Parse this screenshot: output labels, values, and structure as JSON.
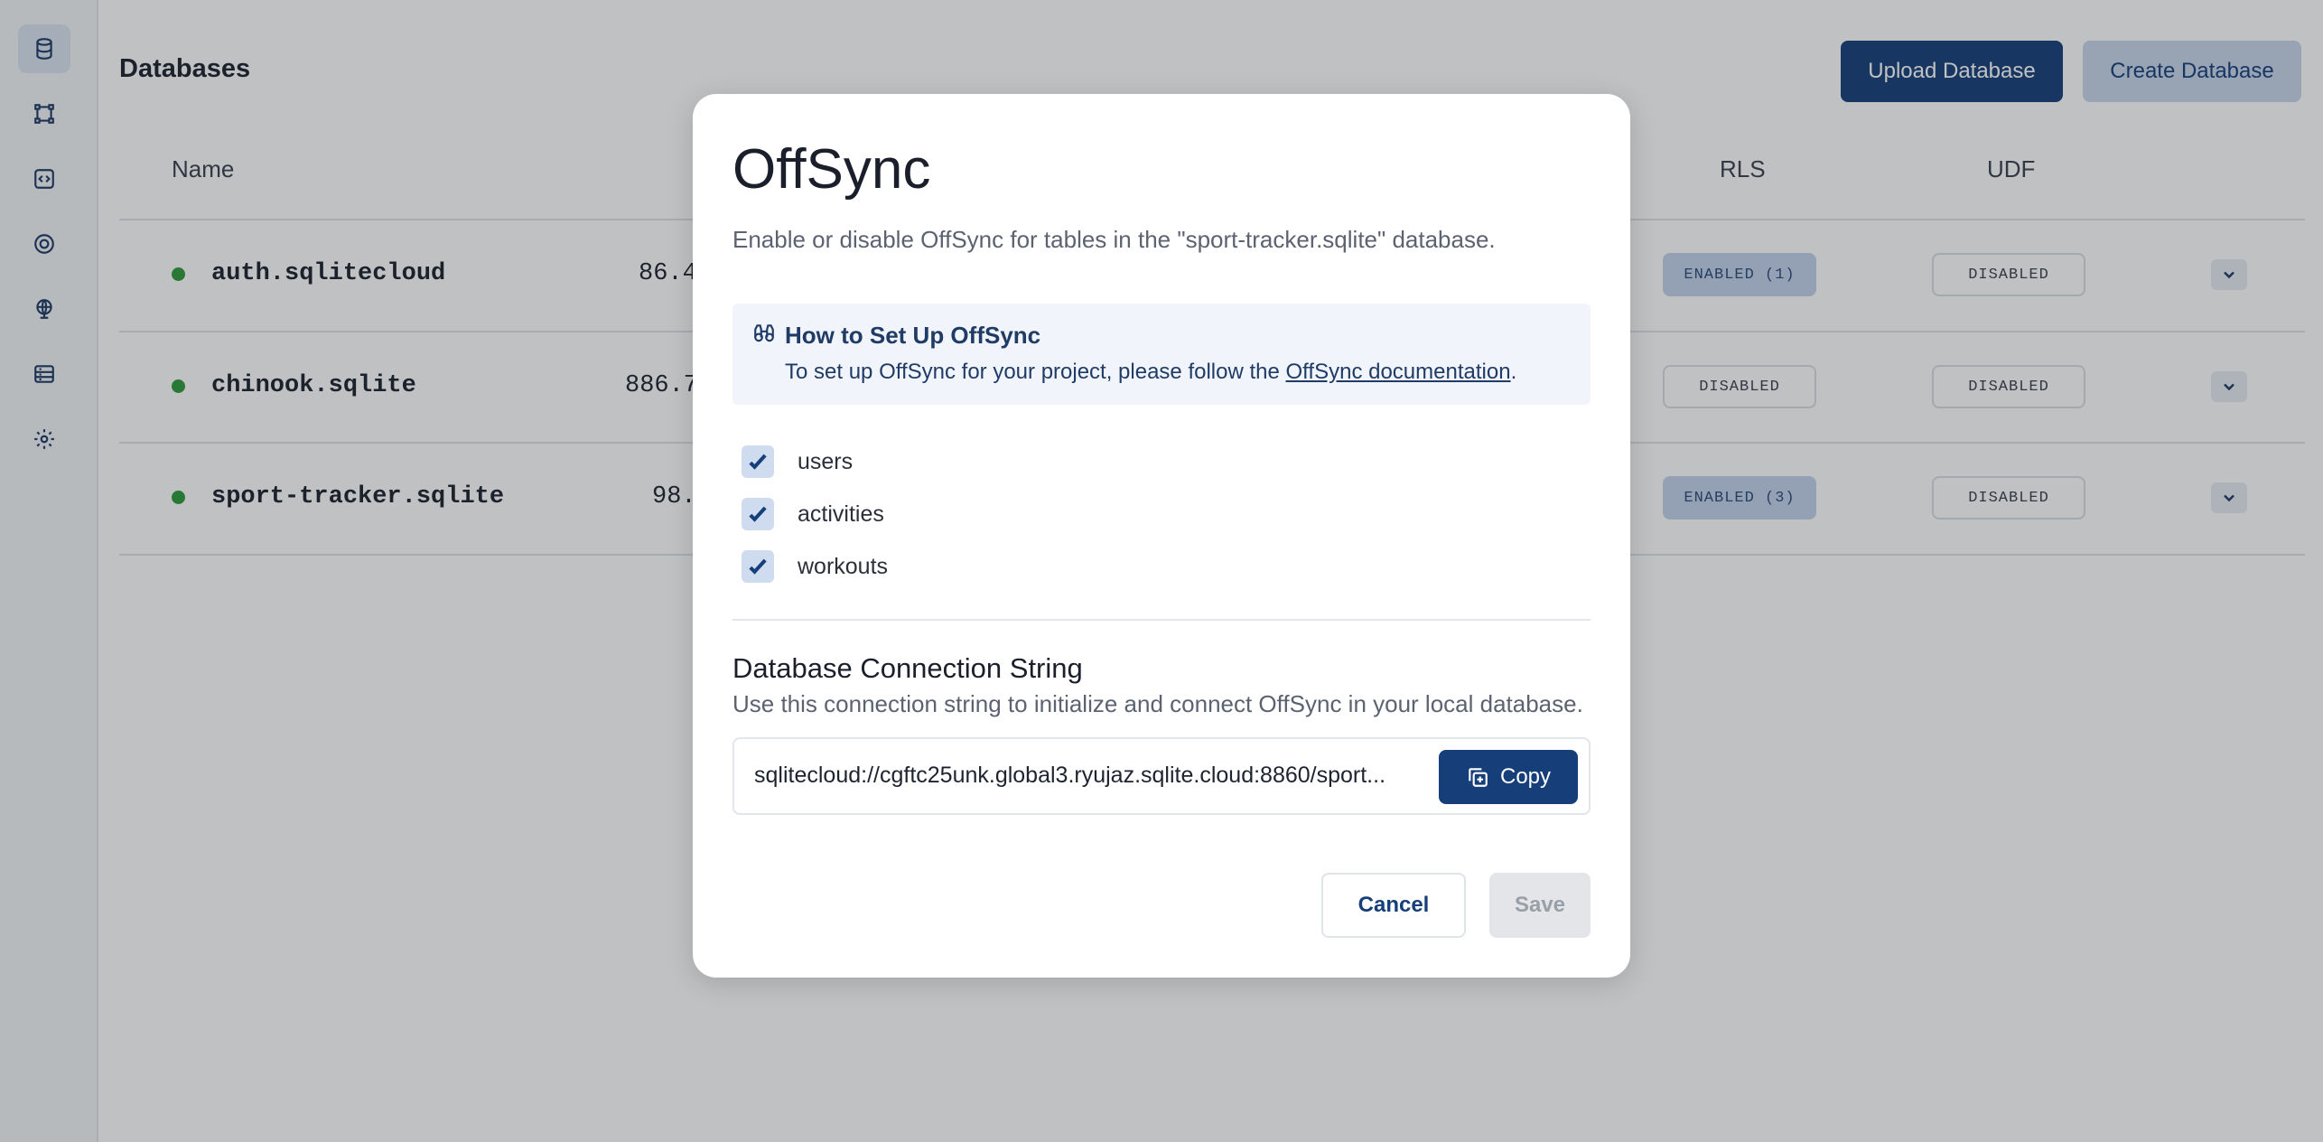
{
  "sidebar": {
    "items": [
      {
        "icon": "database-icon",
        "active": true
      },
      {
        "icon": "nodes-icon",
        "active": false
      },
      {
        "icon": "functions-icon",
        "active": false
      },
      {
        "icon": "gauge-icon",
        "active": false
      },
      {
        "icon": "globe-icon",
        "active": false
      },
      {
        "icon": "server-icon",
        "active": false
      },
      {
        "icon": "gear-icon",
        "active": false
      }
    ]
  },
  "page": {
    "title": "Databases",
    "upload_label": "Upload Database",
    "create_label": "Create Database",
    "columns": {
      "name": "Name",
      "rls": "RLS",
      "udf": "UDF"
    }
  },
  "databases": [
    {
      "name": "auth.sqlitecloud",
      "size": "86.4",
      "rls": "ENABLED (1)",
      "rls_state": "enabled",
      "udf": "DISABLED",
      "status": "online"
    },
    {
      "name": "chinook.sqlite",
      "size": "886.7",
      "rls": "DISABLED",
      "rls_state": "disabled",
      "udf": "DISABLED",
      "status": "online"
    },
    {
      "name": "sport-tracker.sqlite",
      "size": "98.",
      "rls": "ENABLED (3)",
      "rls_state": "enabled",
      "udf": "DISABLED",
      "status": "online"
    }
  ],
  "modal": {
    "title": "OffSync",
    "subtitle": "Enable or disable OffSync for tables in the \"sport-tracker.sqlite\" database.",
    "info": {
      "title": "How to Set Up OffSync",
      "text_before": "To set up OffSync for your project, please follow the ",
      "link": "OffSync documentation",
      "text_after": "."
    },
    "tables": [
      {
        "label": "users",
        "checked": true
      },
      {
        "label": "activities",
        "checked": true
      },
      {
        "label": "workouts",
        "checked": true
      }
    ],
    "connection": {
      "title": "Database Connection String",
      "subtitle": "Use this connection string to initialize and connect OffSync in your local database.",
      "value": "sqlitecloud://cgftc25unk.global3.ryujaz.sqlite.cloud:8860/sport...",
      "copy_label": "Copy"
    },
    "cancel_label": "Cancel",
    "save_label": "Save"
  },
  "colors": {
    "primary": "#163f7a",
    "status_online": "#2f9a3c",
    "badge_enabled": "#c2d3ee"
  }
}
